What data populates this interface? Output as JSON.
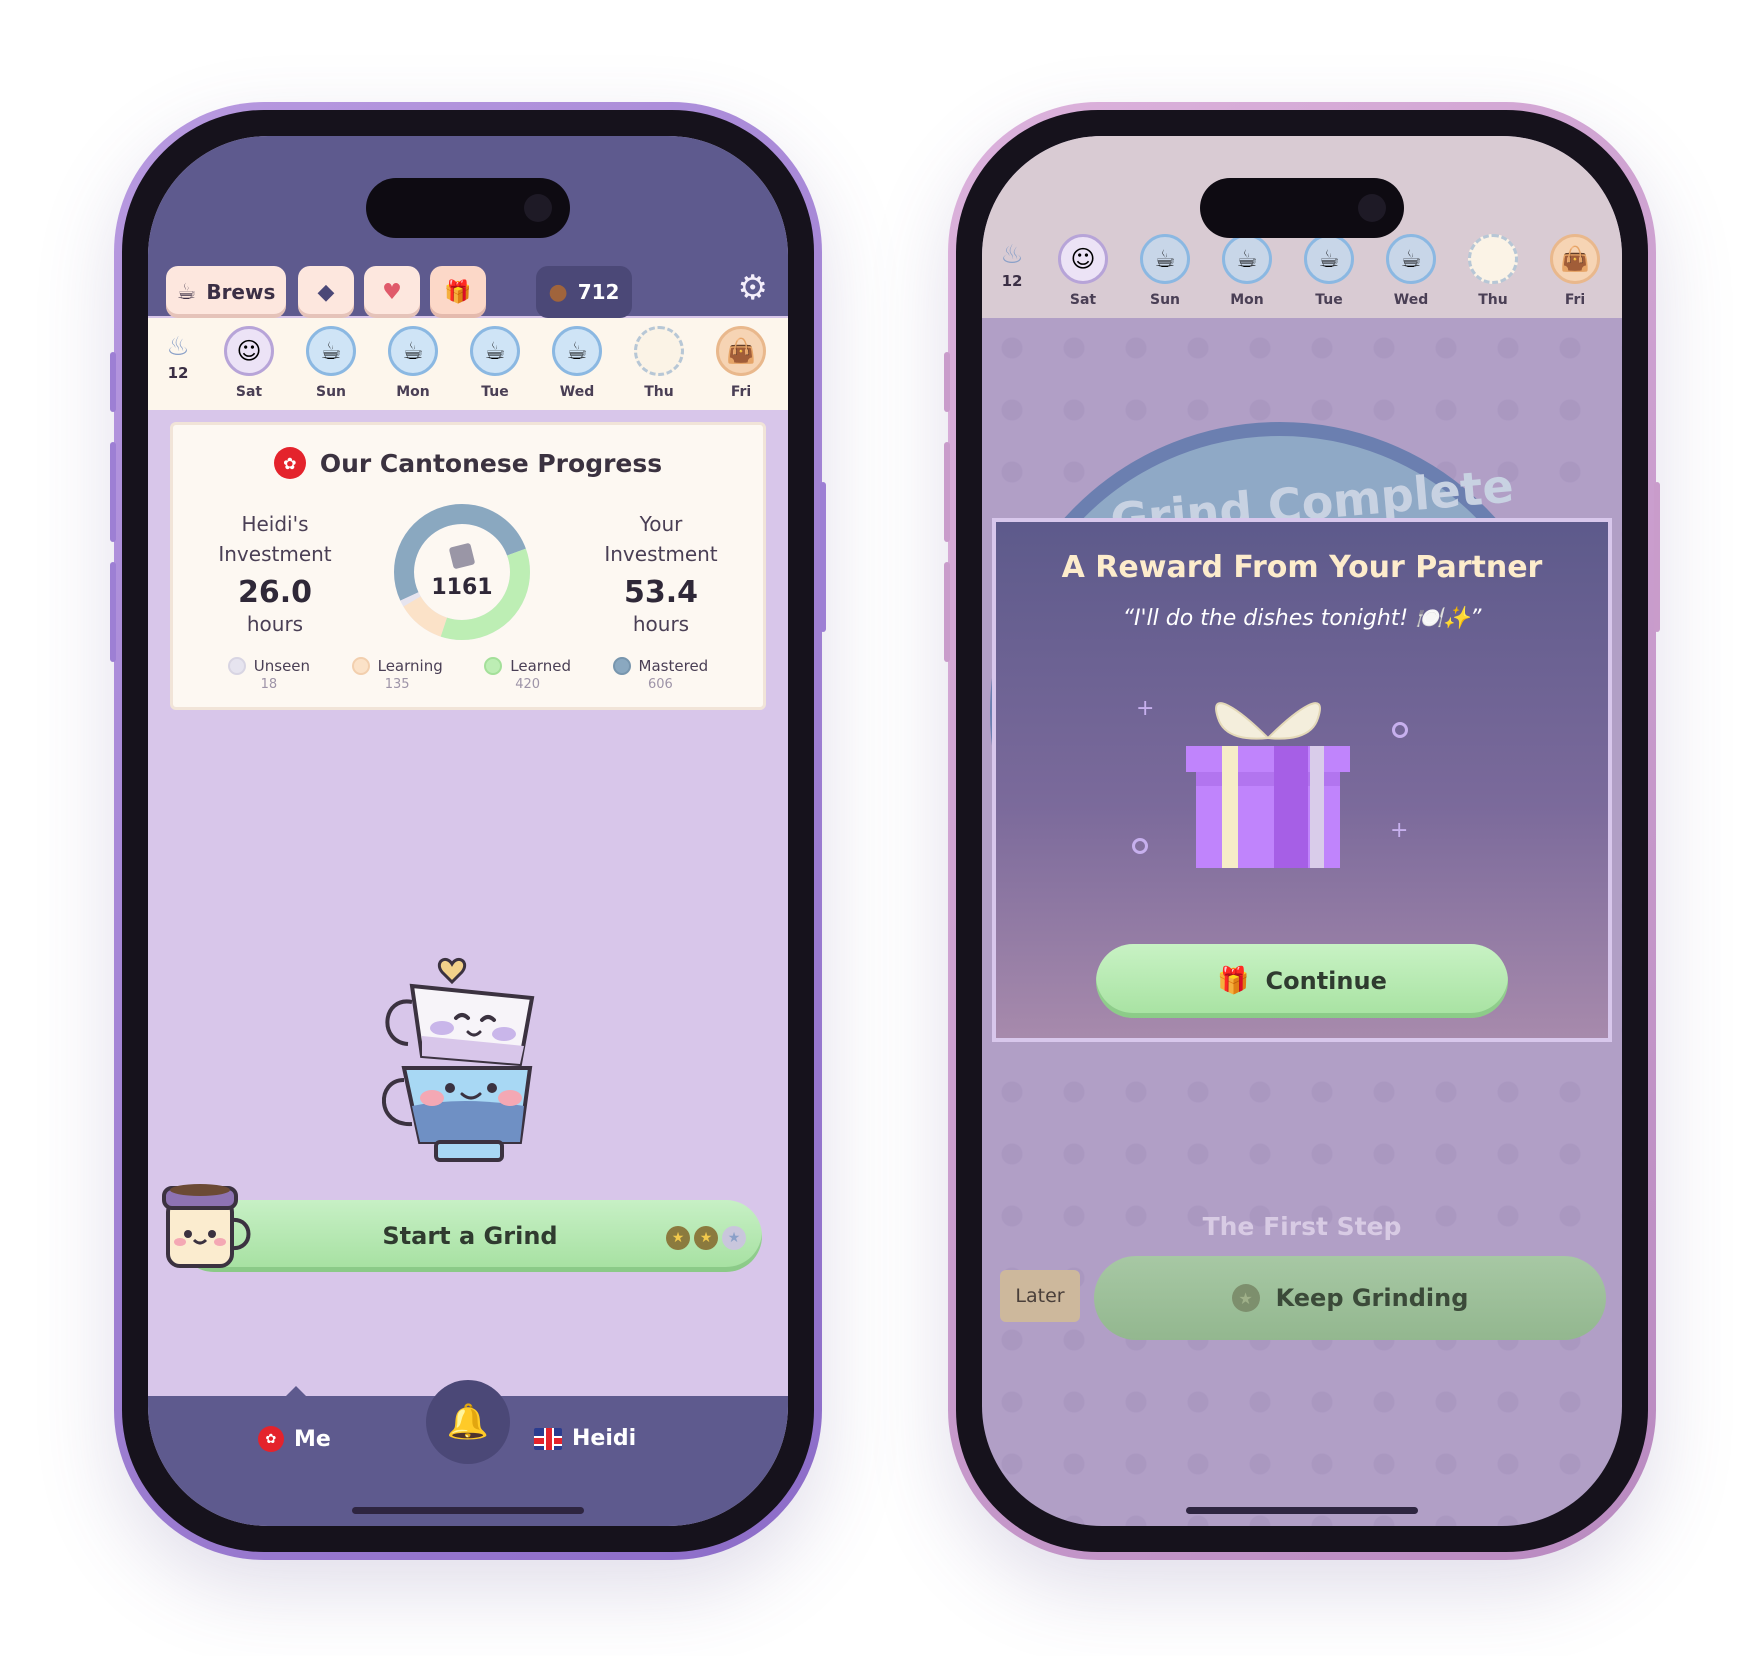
{
  "left_phone": {
    "toolbar": {
      "brews_label": "Brews",
      "brews_icon": "coffee-machine-icon",
      "cards_icon": "cards-icon",
      "heart_icon": "heart-message-icon",
      "gift_icon": "gift-icon",
      "coins_icon": "coffee-bean-icon",
      "coins_value": "712",
      "settings_icon": "gear-icon"
    },
    "week": {
      "streak_icon": "flame-icon",
      "streak_count": "12",
      "days": [
        {
          "label": "Sat",
          "state": "today"
        },
        {
          "label": "Sun",
          "state": "done"
        },
        {
          "label": "Mon",
          "state": "done"
        },
        {
          "label": "Tue",
          "state": "done"
        },
        {
          "label": "Wed",
          "state": "done"
        },
        {
          "label": "Thu",
          "state": "empty"
        },
        {
          "label": "Fri",
          "state": "gift"
        }
      ]
    },
    "progress": {
      "title": "Our Cantonese Progress",
      "partner_label_line1": "Heidi's",
      "partner_label_line2": "Investment",
      "partner_hours": "26.0",
      "hours_unit": "hours",
      "self_label_line1": "Your",
      "self_label_line2": "Investment",
      "self_hours": "53.4",
      "total_cards": "1161",
      "legend": [
        {
          "name": "Unseen",
          "count": "18",
          "color": "#e6e4ef"
        },
        {
          "name": "Learning",
          "count": "135",
          "color": "#fbe2c8"
        },
        {
          "name": "Learned",
          "count": "420",
          "color": "#bdeeb4"
        },
        {
          "name": "Mastered",
          "count": "606",
          "color": "#8aa8c0"
        }
      ]
    },
    "start_button": {
      "label": "Start a Grind",
      "stars_earned": 2,
      "stars_total": 3
    },
    "nav": {
      "me_label": "Me",
      "partner_label": "Heidi",
      "bell_icon": "bell-icon"
    }
  },
  "right_phone": {
    "week": {
      "streak_count": "12",
      "days": [
        "Sat",
        "Sun",
        "Mon",
        "Tue",
        "Wed",
        "Thu",
        "Fri"
      ]
    },
    "background_title": "Grind Complete",
    "modal": {
      "title": "A Reward From Your Partner",
      "quote": "“I'll do the dishes tonight! 🍽️✨”",
      "continue_label": "Continue",
      "continue_icon": "gift-icon"
    },
    "first_step": "The First Step",
    "later_label": "Later",
    "keep_grinding_label": "Keep Grinding"
  },
  "colors": {
    "header_purple": "#5e5a8e",
    "lavender_bg": "#d8c6ea",
    "green_button": "#b5e8b0",
    "gift_purple": "#c084fc"
  }
}
